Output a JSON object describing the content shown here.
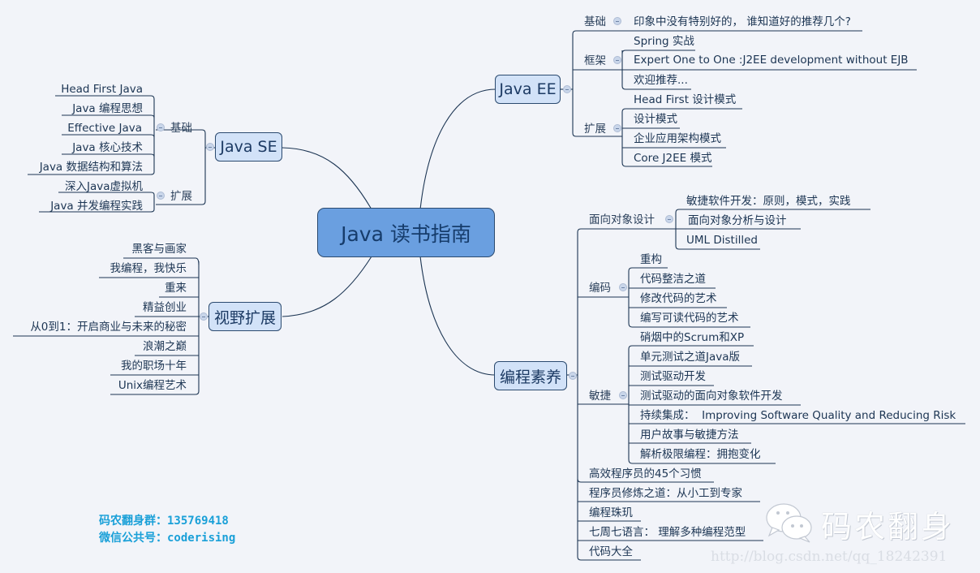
{
  "central": {
    "label": "Java 读书指南"
  },
  "colors": {
    "central_fill": "#6a9fe0",
    "topic_fill": "#d2e2f8",
    "line": "#1c3553",
    "promo": "#1aa0d8"
  },
  "java_se": {
    "label": "Java SE",
    "groups": [
      {
        "label": "基础",
        "items": [
          "Head First Java",
          "Java 编程思想",
          "Effective Java",
          "Java 核心技术",
          "Java 数据结构和算法"
        ]
      },
      {
        "label": "扩展",
        "items": [
          "深入Java虚拟机",
          "Java 并发编程实践"
        ]
      }
    ]
  },
  "vision": {
    "label": "视野扩展",
    "items": [
      "黑客与画家",
      "我编程，我快乐",
      "重来",
      "精益创业",
      "从0到1：开启商业与未来的秘密",
      "浪潮之巅",
      "我的职场十年",
      "Unix编程艺术"
    ]
  },
  "java_ee": {
    "label": "Java EE",
    "groups": [
      {
        "label": "基础",
        "items": [
          "印象中没有特别好的， 谁知道好的推荐几个?"
        ]
      },
      {
        "label": "框架",
        "items": [
          "Spring 实战",
          "Expert One to One :J2EE development without EJB",
          "欢迎推荐..."
        ]
      },
      {
        "label": "扩展",
        "items": [
          "Head First 设计模式",
          "设计模式",
          "企业应用架构模式",
          "Core J2EE 模式"
        ]
      }
    ]
  },
  "literacy": {
    "label": "编程素养",
    "groups": [
      {
        "label": "面向对象设计",
        "items": [
          "敏捷软件开发：原则，模式，实践",
          "面向对象分析与设计",
          "UML Distilled"
        ]
      },
      {
        "label": "编码",
        "items": [
          "重构",
          "代码整洁之道",
          "修改代码的艺术",
          "编写可读代码的艺术"
        ]
      },
      {
        "label": "敏捷",
        "items": [
          "硝烟中的Scrum和XP",
          "单元测试之道Java版",
          "测试驱动开发",
          "测试驱动的面向对象软件开发",
          "持续集成：  Improving Software Quality and Reducing Risk",
          "用户故事与敏捷方法",
          "解析极限编程：拥抱变化"
        ]
      }
    ],
    "leaves": [
      "高效程序员的45个习惯",
      "程序员修炼之道：从小工到专家",
      "编程珠玑",
      "七周七语言： 理解多种编程范型",
      "代码大全"
    ]
  },
  "promo": {
    "qq_group": "码农翻身群：135769418",
    "wechat": "微信公共号：coderising"
  },
  "watermark": {
    "name": "码农翻身",
    "url": "http://blog.csdn.net/qq_18242391"
  },
  "icons": {
    "collapse": "minus-circle-icon",
    "wechat": "wechat-logo-icon"
  }
}
